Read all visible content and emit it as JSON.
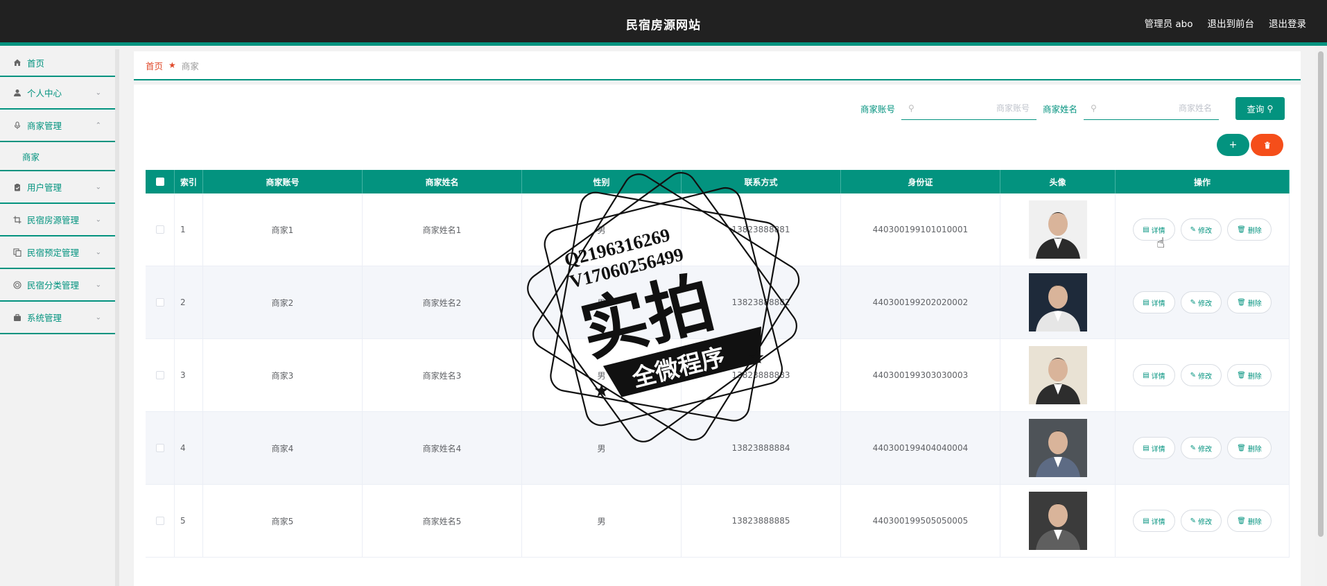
{
  "app": {
    "title": "民宿房源网站",
    "admin_label": "管理员 abo",
    "back_to_front": "退出到前台",
    "logout": "退出登录"
  },
  "sidebar": {
    "items": [
      {
        "label": "首页",
        "icon": "home-icon"
      },
      {
        "label": "个人中心",
        "icon": "user-icon"
      },
      {
        "label": "商家管理",
        "icon": "mic-icon",
        "expanded": true
      },
      {
        "label": "用户管理",
        "icon": "clipboard-icon"
      },
      {
        "label": "民宿房源管理",
        "icon": "crop-icon"
      },
      {
        "label": "民宿预定管理",
        "icon": "copy-icon"
      },
      {
        "label": "民宿分类管理",
        "icon": "target-icon"
      },
      {
        "label": "系统管理",
        "icon": "briefcase-icon"
      }
    ],
    "submenu_label": "商家"
  },
  "breadcrumb": {
    "home": "首页",
    "current": "商家"
  },
  "search": {
    "account_label": "商家账号",
    "account_placeholder": "商家账号",
    "name_label": "商家姓名",
    "name_placeholder": "商家姓名",
    "query_label": "查询"
  },
  "actions": {
    "add_symbol": "+",
    "delete_symbol": "🗑"
  },
  "table": {
    "headers": [
      "索引",
      "商家账号",
      "商家姓名",
      "性别",
      "联系方式",
      "身份证",
      "头像",
      "操作"
    ],
    "rows": [
      {
        "index": "1",
        "account": "商家1",
        "name": "商家姓名1",
        "gender": "男",
        "phone": "13823888881",
        "idcard": "440300199101010001"
      },
      {
        "index": "2",
        "account": "商家2",
        "name": "商家姓名2",
        "gender": "男",
        "phone": "13823888882",
        "idcard": "440300199202020002"
      },
      {
        "index": "3",
        "account": "商家3",
        "name": "商家姓名3",
        "gender": "男",
        "phone": "13823888883",
        "idcard": "440300199303030003"
      },
      {
        "index": "4",
        "account": "商家4",
        "name": "商家姓名4",
        "gender": "男",
        "phone": "13823888884",
        "idcard": "440300199404040004"
      },
      {
        "index": "5",
        "account": "商家5",
        "name": "商家姓名5",
        "gender": "男",
        "phone": "13823888885",
        "idcard": "440300199505050005"
      }
    ],
    "op_labels": {
      "detail": "详情",
      "edit": "修改",
      "delete": "删除"
    }
  },
  "watermark": {
    "line1": "Q2196316269",
    "line2": "V17060256499",
    "main": "实拍",
    "banner": "全微程序"
  },
  "colors": {
    "accent": "#03937f",
    "danger": "#f54e1a",
    "topbar": "#212121"
  }
}
